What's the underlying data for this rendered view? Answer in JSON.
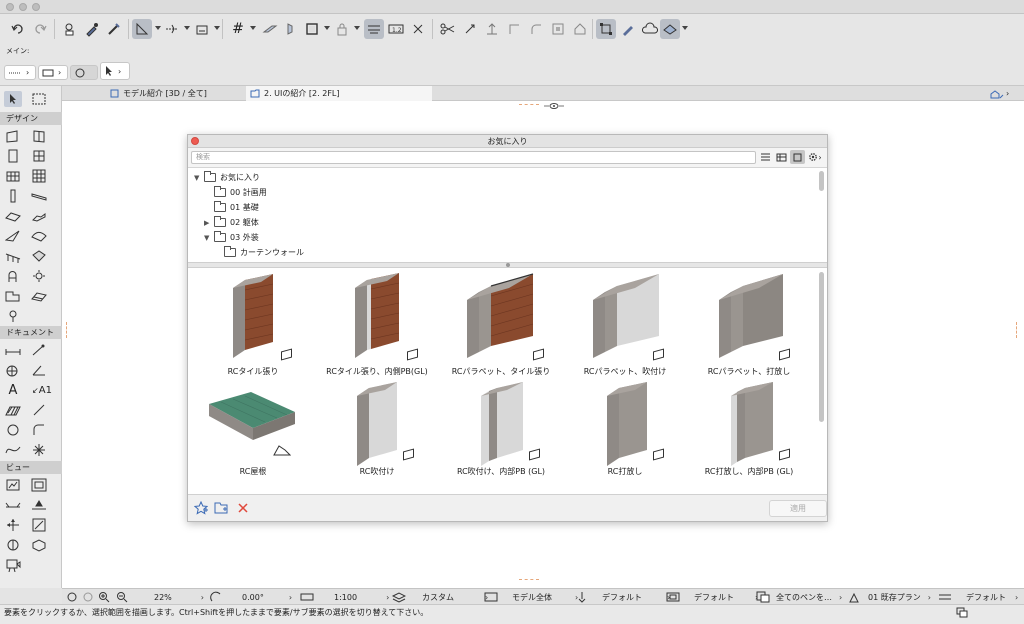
{
  "infobox": {
    "main_label": "メイン:"
  },
  "tabs": [
    {
      "label": "モデル紹介 [3D / 全て]"
    },
    {
      "label": "2. UIの紹介 [2. 2FL]"
    }
  ],
  "toolbox": {
    "sections": {
      "design": "デザイン",
      "document": "ドキュメント",
      "view": "ビュー"
    },
    "a1_label": "A1"
  },
  "panel": {
    "title": "お気に入り",
    "search_placeholder": "検索",
    "tree": [
      {
        "label": "お気に入り"
      },
      {
        "label": "00 計画用"
      },
      {
        "label": "01 基礎"
      },
      {
        "label": "02 躯体"
      },
      {
        "label": "03 外装"
      },
      {
        "label": "カーテンウォール"
      }
    ],
    "items": [
      {
        "label": "RCタイル張り"
      },
      {
        "label": "RCタイル張り、内側PB(GL)"
      },
      {
        "label": "RCパラペット、タイル張り"
      },
      {
        "label": "RCパラペット、吹付け"
      },
      {
        "label": "RCパラペット、打放し"
      },
      {
        "label": "RC屋根"
      },
      {
        "label": "RC吹付け"
      },
      {
        "label": "RC吹付け、内部PB (GL)"
      },
      {
        "label": "RC打放し"
      },
      {
        "label": "RC打放し、内部PB (GL)"
      }
    ],
    "apply_label": "適用"
  },
  "statusbar": {
    "zoom": "22%",
    "angle": "0.00°",
    "scale": "1:100",
    "layer": "カスタム",
    "model": "モデル全体",
    "pen1": "デフォルト",
    "pen2": "デフォルト",
    "pens": "全てのペンを…",
    "renovation": "01 既存プラン",
    "dim": "デフォルト"
  },
  "message": "要素をクリックするか、選択範囲を描画します。Ctrl+Shiftを押したままで要素/サブ要素の選択を切り替えて下さい。",
  "colors": {
    "brick": "#8a4a2e",
    "concrete": "#9a9590",
    "roof": "#4b8a72",
    "plaster": "#d8d8d8"
  }
}
